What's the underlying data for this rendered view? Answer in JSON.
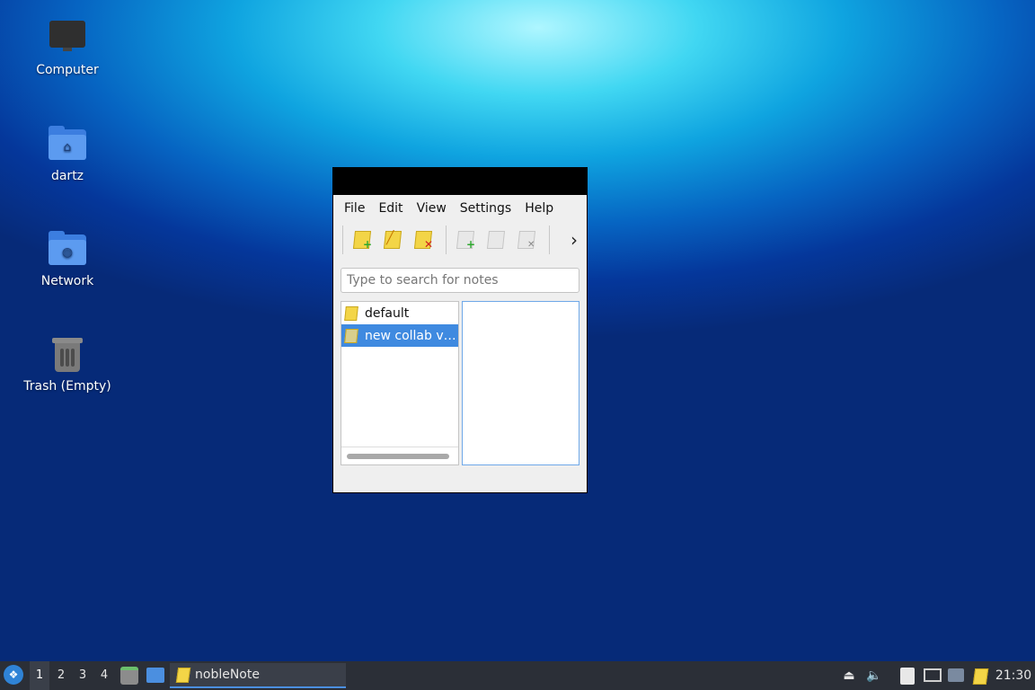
{
  "desktop": {
    "icons": [
      {
        "label": "Computer",
        "icon": "computer-icon"
      },
      {
        "label": "dartz",
        "icon": "home-folder-icon"
      },
      {
        "label": "Network",
        "icon": "network-folder-icon"
      },
      {
        "label": "Trash (Empty)",
        "icon": "trash-icon"
      }
    ]
  },
  "window": {
    "menu": [
      "File",
      "Edit",
      "View",
      "Settings",
      "Help"
    ],
    "toolbar": {
      "buttons": [
        "new-folder-icon",
        "rename-folder-icon",
        "delete-folder-icon",
        "new-note-icon",
        "rename-note-icon",
        "delete-note-icon"
      ],
      "overflow": "›"
    },
    "search": {
      "placeholder": "Type to search for notes",
      "value": ""
    },
    "folders": [
      {
        "label": "default",
        "selected": false
      },
      {
        "label": "new collab v…",
        "selected": true
      }
    ],
    "notes": []
  },
  "taskbar": {
    "workspaces": [
      "1",
      "2",
      "3",
      "4"
    ],
    "active_workspace": "1",
    "task_label": "nobleNote",
    "clock": "21:30"
  },
  "colors": {
    "selection": "#3f8ae0",
    "taskbar": "#2b2f37",
    "note_yellow": "#f3d547"
  }
}
